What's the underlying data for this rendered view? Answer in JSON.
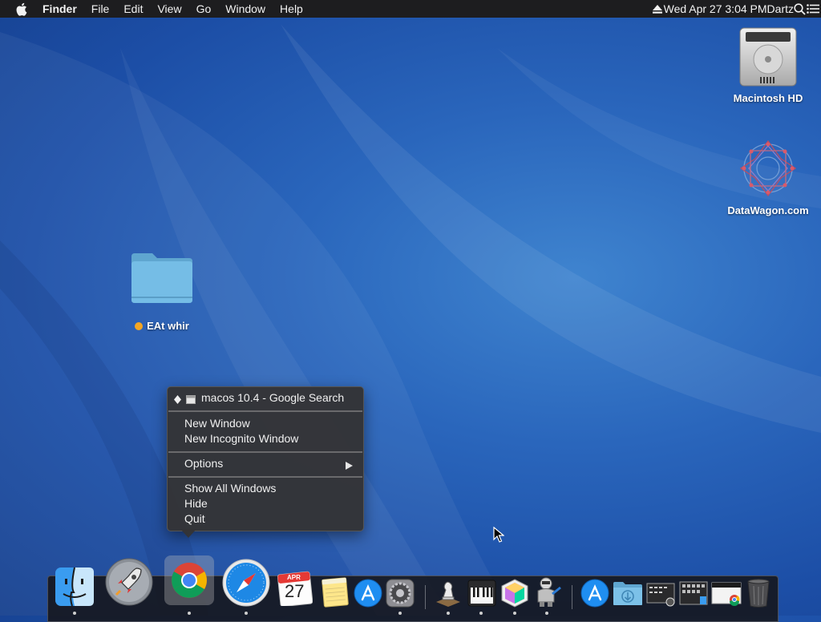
{
  "menubar": {
    "apple_icon": "apple-icon",
    "app_name": "Finder",
    "menus": [
      "File",
      "Edit",
      "View",
      "Go",
      "Window",
      "Help"
    ],
    "eject_icon": "eject-icon",
    "clock": "Wed Apr 27  3:04 PM",
    "user": "Dartz",
    "spotlight_icon": "search-icon",
    "notification_icon": "list-icon"
  },
  "desktop": {
    "macintosh_hd": "Macintosh HD",
    "datawagon": "DataWagon.com",
    "folder": "EAt whir",
    "folder_tag_color": "#f5a623"
  },
  "context_menu": {
    "window_title": "macos 10.4 - Google Search",
    "items": [
      "New Window",
      "New Incognito Window",
      "Options",
      "Show All Windows",
      "Hide",
      "Quit"
    ]
  },
  "dock": {
    "calendar_month": "APR",
    "calendar_day": "27",
    "apps": [
      "Finder",
      "Launchpad",
      "Google Chrome",
      "Safari",
      "Calendar",
      "Notes",
      "App Store",
      "System Preferences",
      "Chess",
      "Piano",
      "Grapher",
      "Automator",
      "App Store",
      "Downloads",
      "Screenshot",
      "Stacks",
      "Chrome Window",
      "Trash"
    ]
  },
  "colors": {
    "menubar_bg": "#1d1d1f",
    "desktop_blue": "#2a66bc",
    "menu_bg": "#343436"
  }
}
